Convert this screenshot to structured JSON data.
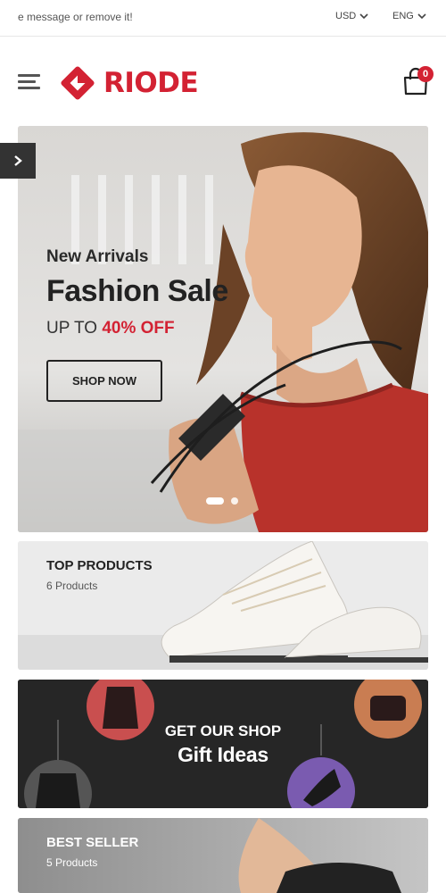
{
  "topbar": {
    "message": "e message or remove it!",
    "currency": "USD",
    "language": "ENG"
  },
  "header": {
    "logo_text": "RIODE",
    "cart_count": "0",
    "brand_color": "#d32233"
  },
  "hero": {
    "subtitle": "New Arrivals",
    "title": "Fashion Sale",
    "offer_prefix": "UP TO ",
    "offer_highlight": "40% OFF",
    "button_label": "SHOP NOW",
    "slide_count": 2,
    "active_slide": 1
  },
  "categories": [
    {
      "title": "TOP PRODUCTS",
      "count": "6 Products"
    },
    {
      "title_line1": "GET OUR SHOP",
      "title_line2": "Gift Ideas"
    },
    {
      "title": "BEST SELLER",
      "count": "5 Products"
    }
  ],
  "icons": {
    "menu": "hamburger-icon",
    "cart": "shopping-bag-icon",
    "slider_next": "chevron-right-icon",
    "dropdown": "chevron-down-icon"
  }
}
